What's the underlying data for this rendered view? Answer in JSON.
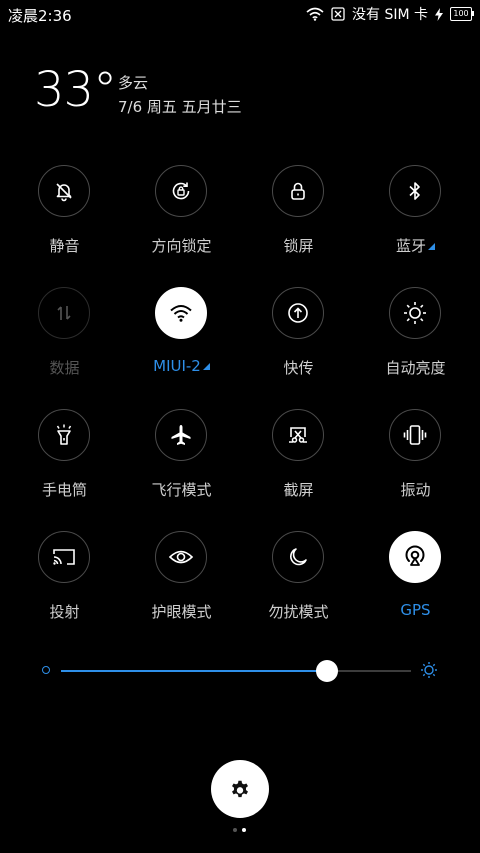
{
  "status_bar": {
    "time": "凌晨2:36",
    "carrier": "没有 SIM 卡",
    "battery": "100"
  },
  "weather": {
    "temperature": "33°",
    "condition": "多云",
    "date": "7/6  周五  五月廿三"
  },
  "tiles": [
    {
      "label": "静音",
      "icon": "bell-off-icon",
      "state": "off"
    },
    {
      "label": "方向锁定",
      "icon": "rotation-lock-icon",
      "state": "off"
    },
    {
      "label": "锁屏",
      "icon": "lock-icon",
      "state": "off"
    },
    {
      "label": "蓝牙",
      "icon": "bluetooth-icon",
      "state": "off",
      "has_menu": true
    },
    {
      "label": "数据",
      "icon": "mobile-data-icon",
      "state": "disabled"
    },
    {
      "label": "MIUI-2",
      "icon": "wifi-icon",
      "state": "on",
      "has_menu": true
    },
    {
      "label": "快传",
      "icon": "quick-transfer-icon",
      "state": "off"
    },
    {
      "label": "自动亮度",
      "icon": "auto-brightness-icon",
      "state": "off"
    },
    {
      "label": "手电筒",
      "icon": "flashlight-icon",
      "state": "off"
    },
    {
      "label": "飞行模式",
      "icon": "airplane-icon",
      "state": "off"
    },
    {
      "label": "截屏",
      "icon": "screenshot-icon",
      "state": "off"
    },
    {
      "label": "振动",
      "icon": "vibrate-icon",
      "state": "off"
    },
    {
      "label": "投射",
      "icon": "cast-icon",
      "state": "off"
    },
    {
      "label": "护眼模式",
      "icon": "eye-icon",
      "state": "off"
    },
    {
      "label": "勿扰模式",
      "icon": "moon-icon",
      "state": "off"
    },
    {
      "label": "GPS",
      "icon": "gps-icon",
      "state": "on"
    }
  ],
  "brightness": {
    "level": 0.76
  },
  "pager": {
    "pages": 2,
    "current": 2
  },
  "colors": {
    "accent": "#2e8fe8",
    "background": "#000000"
  }
}
